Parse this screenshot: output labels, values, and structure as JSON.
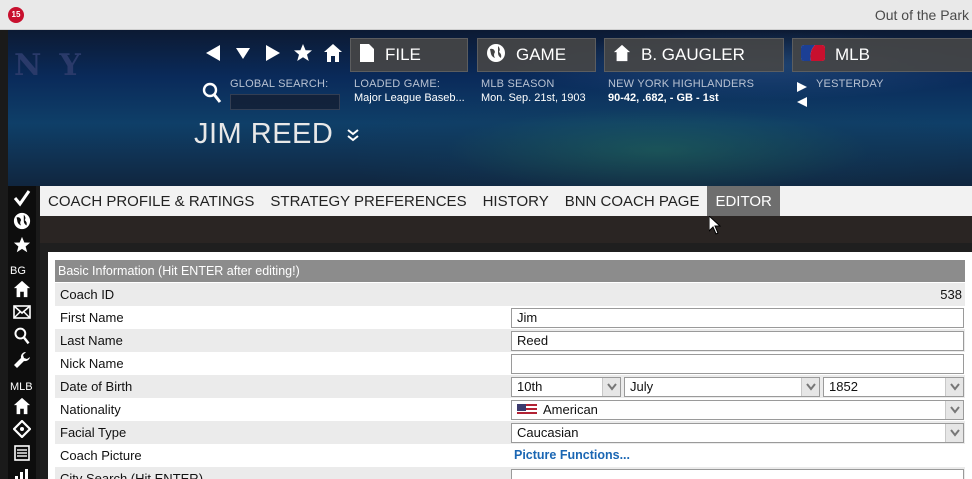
{
  "window": {
    "app_icon_text": "15",
    "title": "Out of the Park"
  },
  "header": {
    "team_logo": "NY",
    "nav": [
      "back-arrow-icon",
      "dropdown-arrow-icon",
      "forward-arrow-icon",
      "star-icon",
      "home-icon"
    ],
    "menus": [
      {
        "label": "FILE",
        "icon": "file-icon"
      },
      {
        "label": "GAME",
        "icon": "globe-icon"
      },
      {
        "label": "B. GAUGLER",
        "icon": "home-icon"
      },
      {
        "label": "MLB",
        "icon": "mlb-logo-icon"
      }
    ],
    "global_search": {
      "label": "GLOBAL SEARCH:",
      "value": ""
    },
    "loaded_game": {
      "label": "LOADED GAME:",
      "value": "Major League Baseb..."
    },
    "season": {
      "label": "MLB SEASON",
      "value": "Mon. Sep. 21st, 1903"
    },
    "team": {
      "label": "NEW YORK HIGHLANDERS",
      "value": "90-42, .682, - GB - 1st"
    },
    "yesterday": {
      "label": "YESTERDAY"
    },
    "person_name": "JIM REED"
  },
  "sidebar": {
    "items": [
      "checkmark-icon",
      "globe-icon",
      "star-icon",
      "BG",
      "home-icon",
      "mail-icon",
      "search-icon",
      "wrench-icon",
      "MLB",
      "home-icon",
      "baseball-diamond-icon",
      "list-icon",
      "chart-icon"
    ],
    "bg_label": "BG",
    "mlb_label": "MLB"
  },
  "tabs": [
    {
      "label": "COACH PROFILE & RATINGS",
      "active": false
    },
    {
      "label": "STRATEGY PREFERENCES",
      "active": false
    },
    {
      "label": "HISTORY",
      "active": false
    },
    {
      "label": "BNN COACH PAGE",
      "active": false
    },
    {
      "label": "EDITOR",
      "active": true
    }
  ],
  "form": {
    "section_title": "Basic Information (Hit ENTER after editing!)",
    "coach_id": {
      "label": "Coach ID",
      "value": "538"
    },
    "first_name": {
      "label": "First Name",
      "value": "Jim"
    },
    "last_name": {
      "label": "Last Name",
      "value": "Reed"
    },
    "nick_name": {
      "label": "Nick Name",
      "value": ""
    },
    "dob": {
      "label": "Date of Birth",
      "day": "10th",
      "month": "July",
      "year": "1852"
    },
    "nationality": {
      "label": "Nationality",
      "value": "American"
    },
    "facial_type": {
      "label": "Facial Type",
      "value": "Caucasian"
    },
    "coach_picture": {
      "label": "Coach Picture",
      "link": "Picture Functions..."
    },
    "city_search": {
      "label": "City Search (Hit ENTER)",
      "value": ""
    }
  },
  "colors": {
    "active_tab": "#6e6e6e",
    "link": "#1a66b3",
    "section_header": "#8c8c8c"
  }
}
